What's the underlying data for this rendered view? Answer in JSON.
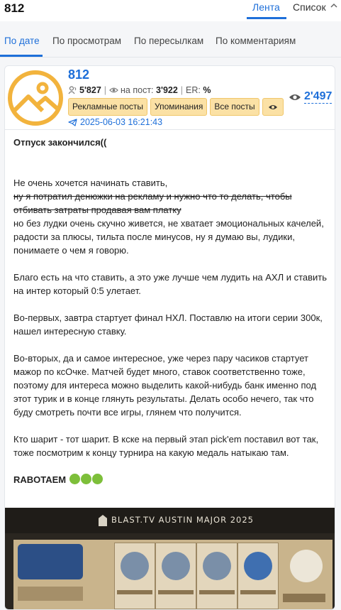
{
  "header": {
    "title": "812",
    "tabs": [
      {
        "label": "Лента",
        "active": true
      },
      {
        "label": "Список",
        "active": false
      }
    ]
  },
  "sort_tabs": [
    {
      "label": "По дате",
      "active": true
    },
    {
      "label": "По просмотрам",
      "active": false
    },
    {
      "label": "По пересылкам",
      "active": false
    },
    {
      "label": "По комментариям",
      "active": false
    }
  ],
  "post": {
    "channel_name": "812",
    "subscribers": "5'827",
    "views_per_post_label": "на пост:",
    "views_per_post": "3'922",
    "er_label": "ER:",
    "er_value": "%",
    "buttons": {
      "ads": "Рекламные посты",
      "mentions": "Упоминания",
      "all_posts": "Все посты"
    },
    "date": "2025-06-03 16:21:43",
    "views": "2'497",
    "text": {
      "title": "Отпуск закончился((",
      "p1": "Не очень хочется начинать ставить,",
      "p1_strike": "ну я потратил денюжки на рекламу и нужно что то делать, чтобы отбивать затраты продавая вам платку",
      "p1_rest": "но без лудки очень скучно живется, не хватает эмоциональных качелей, радости за плюсы, тильта после минусов, ну я думаю вы, лудики, понимаете о чем я говорю.",
      "p2": "Благо есть на что ставить, а это уже лучше чем лудить на АХЛ и ставить на интер который 0:5 улетает.",
      "p3": "Во-первых, завтра стартует финал НХЛ. Поставлю на итоги серии 300к, нашел интересную ставку.",
      "p4": "Во-вторых, да и самое интересное, уже через пару часиков стартует мажор по ксОчке. Матчей будет много, ставок соответственно тоже, поэтому для интереса можно выделить какой-нибудь банк именно под этот турик и в конце глянуть результаты. Делать особо нечего, так что буду смотреть почти все игры, глянем что получится.",
      "p5": "Кто шарит - тот шарит. В кске на первый этап pick'em поставил вот так, тоже посмотрим к концу турнира на какую медаль натыкаю там.",
      "p6": "RABOTAEM"
    },
    "image": {
      "banner_title": "BLAST.TV AUSTIN MAJOR 2025"
    }
  },
  "colors": {
    "accent": "#1e6fd9",
    "button_bg": "#fbe1a5",
    "avatar": "#f2b33d"
  }
}
